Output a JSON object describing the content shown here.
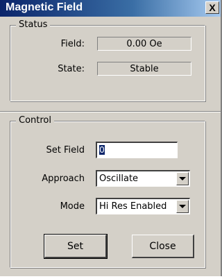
{
  "window": {
    "title": "Magnetic Field",
    "close_glyph": "X"
  },
  "status": {
    "legend": "Status",
    "field_label": "Field:",
    "field_value": "0.00 Oe",
    "state_label": "State:",
    "state_value": "Stable"
  },
  "control": {
    "legend": "Control",
    "set_field_label": "Set Field",
    "set_field_value": "0",
    "approach_label": "Approach",
    "approach_selected": "Oscillate",
    "mode_label": "Mode",
    "mode_selected": "Hi Res Enabled",
    "set_button": "Set",
    "close_button": "Close"
  }
}
